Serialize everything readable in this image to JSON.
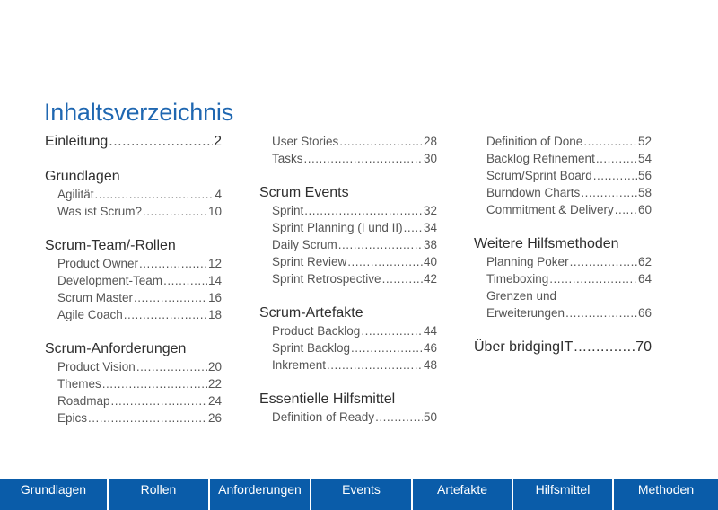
{
  "title": "Inhaltsverzeichnis",
  "toc": {
    "col1": {
      "intro": {
        "label": "Einleitung",
        "page": "2"
      },
      "sections": [
        {
          "heading": "Grundlagen",
          "items": [
            {
              "label": "Agilität",
              "page": "4"
            },
            {
              "label": "Was ist Scrum?",
              "page": "10"
            }
          ]
        },
        {
          "heading": "Scrum-Team/-Rollen",
          "items": [
            {
              "label": "Product Owner",
              "page": "12"
            },
            {
              "label": "Development-Team",
              "page": "14"
            },
            {
              "label": "Scrum Master",
              "page": "16"
            },
            {
              "label": "Agile Coach",
              "page": "18"
            }
          ]
        },
        {
          "heading": "Scrum-Anforderungen",
          "items": [
            {
              "label": "Product Vision",
              "page": "20"
            },
            {
              "label": "Themes",
              "page": "22"
            },
            {
              "label": "Roadmap",
              "page": "24"
            },
            {
              "label": "Epics",
              "page": "26"
            }
          ]
        }
      ]
    },
    "col2": {
      "continued_items": [
        {
          "label": "User Stories",
          "page": "28"
        },
        {
          "label": "Tasks",
          "page": "30"
        }
      ],
      "sections": [
        {
          "heading": "Scrum Events",
          "items": [
            {
              "label": "Sprint",
              "page": "32"
            },
            {
              "label": "Sprint Planning (I und II)",
              "page": "34"
            },
            {
              "label": "Daily Scrum",
              "page": "38"
            },
            {
              "label": "Sprint Review",
              "page": "40"
            },
            {
              "label": "Sprint Retrospective",
              "page": "42"
            }
          ]
        },
        {
          "heading": "Scrum-Artefakte",
          "items": [
            {
              "label": "Product Backlog",
              "page": "44"
            },
            {
              "label": "Sprint Backlog",
              "page": "46"
            },
            {
              "label": "Inkrement",
              "page": "48"
            }
          ]
        },
        {
          "heading": "Essentielle Hilfsmittel",
          "items": [
            {
              "label": "Definition of Ready",
              "page": "50"
            }
          ]
        }
      ]
    },
    "col3": {
      "continued_items": [
        {
          "label": "Definition of Done",
          "page": "52"
        },
        {
          "label": "Backlog Refinement",
          "page": "54"
        },
        {
          "label": "Scrum/Sprint Board",
          "page": "56"
        },
        {
          "label": "Burndown Charts",
          "page": "58"
        },
        {
          "label": "Commitment & Delivery",
          "page": "60"
        }
      ],
      "sections": [
        {
          "heading": "Weitere Hilfsmethoden",
          "items": [
            {
              "label": "Planning Poker",
              "page": "62"
            },
            {
              "label": "Timeboxing",
              "page": "64"
            },
            {
              "label_line1": "Grenzen und",
              "label": "Erweiterungen",
              "page": "66"
            }
          ]
        }
      ],
      "outro": {
        "label": "Über bridgingIT",
        "page": "70"
      }
    }
  },
  "nav": [
    {
      "label": "Grundlagen"
    },
    {
      "label": "Rollen"
    },
    {
      "label": "Anforderungen"
    },
    {
      "label": "Events"
    },
    {
      "label": "Artefakte"
    },
    {
      "label": "Hilfsmittel"
    },
    {
      "label": "Methoden"
    }
  ],
  "colors": {
    "title": "#1f67b1",
    "navbar": "#0a5ca9",
    "heading_text": "#2e2e2e",
    "item_text": "#555555"
  }
}
